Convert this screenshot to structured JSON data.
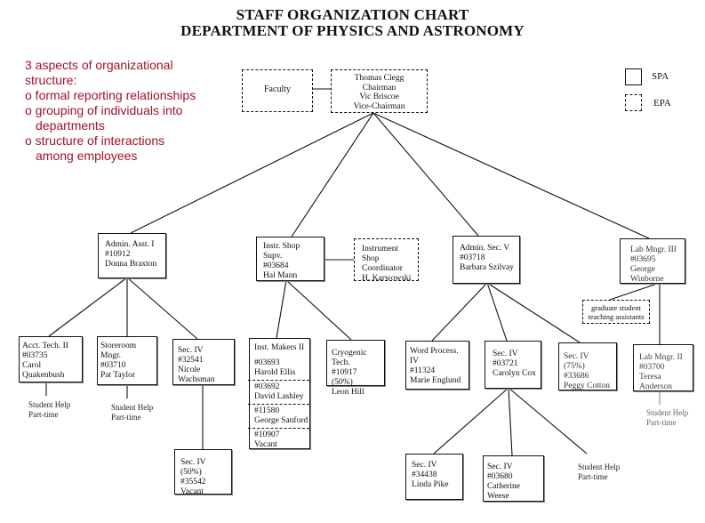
{
  "title": {
    "line1": "STAFF ORGANIZATION CHART",
    "line2": "DEPARTMENT OF PHYSICS AND ASTRONOMY"
  },
  "notes": {
    "heading_line1": "3 aspects of organizational",
    "heading_line2": "structure:",
    "items": [
      {
        "line1": "o formal reporting relationships"
      },
      {
        "line1": "o grouping of individuals into",
        "line2": "departments"
      },
      {
        "line1": "o structure of interactions",
        "line2": "among employees"
      }
    ]
  },
  "legend": {
    "spa": "SPA",
    "epa": "EPA"
  },
  "top": {
    "faculty": "Faculty",
    "chairman": [
      "Thomas Clegg",
      "Chairman",
      "Vic Briscoe",
      "Vice-Chairman"
    ]
  },
  "level2": {
    "admin_asst": [
      "Admin. Asst. I",
      "#10912",
      "Donna Braxton"
    ],
    "instr_shop": [
      "Instr. Shop Supv.",
      "#03684",
      "Hal Mann"
    ],
    "instr_coord": [
      "Instrument Shop",
      "Coordinator",
      "H. Karwowski"
    ],
    "admin_sec": [
      "Admin. Sec. V",
      "#03718",
      "Barbara Szilvay"
    ],
    "lab_mngr3": [
      "Lab Mngr. III",
      "#03695",
      "George Winborne"
    ]
  },
  "level3": {
    "acct_tech": [
      "Acct. Tech. II",
      "#03735",
      "Carol Quakenbush"
    ],
    "storeroom": [
      "Storeroom Mngr.",
      "#03710",
      "Pat Taylor"
    ],
    "sec_iv_nicole": [
      "Sec. IV",
      "#32541",
      "Nicole Wachsman"
    ],
    "inst_makers": {
      "heading": "Inst. Makers II",
      "members": [
        [
          "#03693",
          "Harold Ellis"
        ],
        [
          "#03692",
          "David Lashley"
        ],
        [
          "#11580",
          "George Sanford"
        ],
        [
          "#10907",
          "Vacant"
        ]
      ]
    },
    "cryogenic": [
      "Cryogenic Tech.",
      "#10917 (50%)",
      "Leon Hill"
    ],
    "word_process": [
      "Word Process. IV",
      "#11324",
      "Marie Englund"
    ],
    "sec_iv_carolyn": [
      "Sec. IV",
      "#03721",
      "Carolyn Cox"
    ],
    "sec_iv_peggy": [
      "Sec. IV (75%)",
      "#33686",
      "Peggy Cotton"
    ],
    "grad_ta": [
      "graduate student",
      "teaching assistants"
    ],
    "lab_mngr2": [
      "Lab Mngr. II",
      "#03700",
      "Teresa Anderson"
    ]
  },
  "level4": {
    "sec_iv_vacant": [
      "Sec. IV (50%)",
      "#35542",
      "Vacant"
    ],
    "sec_iv_linda": [
      "Sec. IV",
      "#34438",
      "Linda Pike"
    ],
    "sec_iv_catherine": [
      "Sec. IV",
      "#03680",
      "Catherine Weese"
    ]
  },
  "student_help": {
    "line1": "Student Help",
    "line2": "Part-time"
  }
}
